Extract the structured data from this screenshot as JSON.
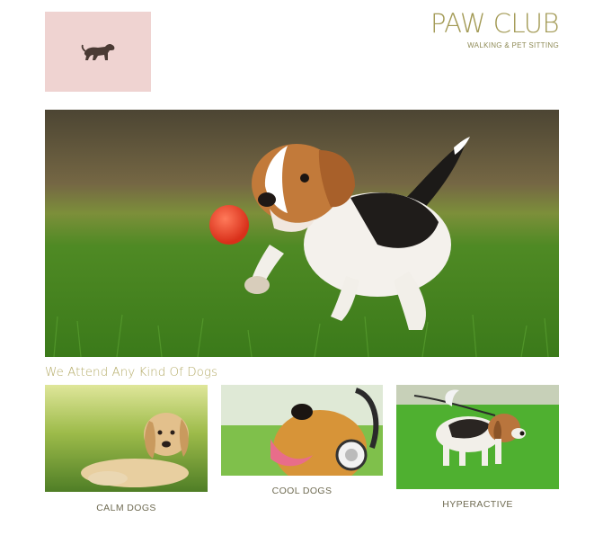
{
  "header": {
    "logo_icon": "dog-icon",
    "title": "PAW CLUB",
    "subtitle": "WALKING & PET SITTING"
  },
  "hero": {
    "image": "beagle-puppy-with-ball"
  },
  "section": {
    "heading": "We Attend Any Kind Of Dogs"
  },
  "gallery": [
    {
      "caption": "CALM DOGS",
      "image": "golden-retriever-puppy-lying"
    },
    {
      "caption": "COOL DOGS",
      "image": "golden-retriever-with-headphones"
    },
    {
      "caption": "HYPERACTIVE",
      "image": "beagle-puppy-on-leash"
    }
  ],
  "colors": {
    "logo_bg": "#efd3d1",
    "brand": "#a39a55",
    "heading": "#b6ad6a",
    "caption": "#6f6b52"
  }
}
